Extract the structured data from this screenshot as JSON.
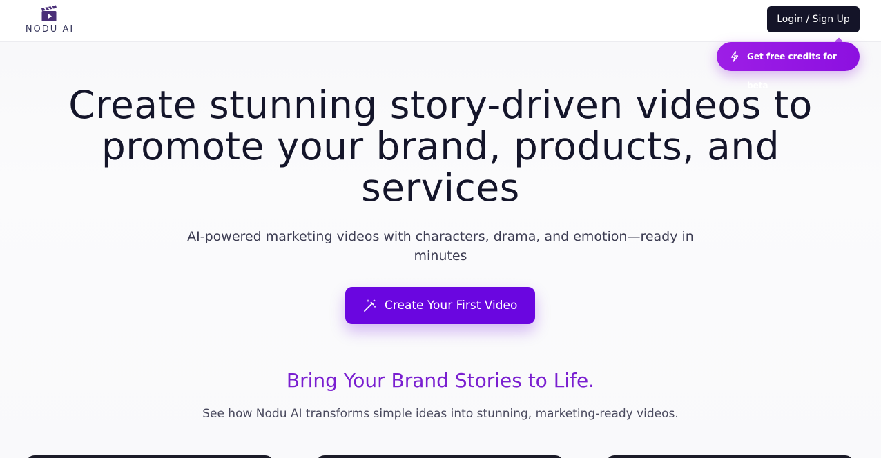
{
  "header": {
    "logo_text": "NODU AI",
    "login_label": "Login / Sign Up",
    "credits_label": "Get free credits for beta"
  },
  "hero": {
    "title": "Create stunning story-driven videos to promote your brand, products, and services",
    "subtitle": "AI-powered marketing videos with characters, drama, and emotion—ready in minutes",
    "cta_label": "Create Your First Video"
  },
  "section": {
    "title": "Bring Your Brand Stories to Life.",
    "subtitle": "See how Nodu AI transforms simple ideas into stunning, marketing-ready videos."
  },
  "icons": {
    "logo": "clapperboard-play-icon",
    "credits": "lightning-bolt-icon",
    "cta": "magic-wand-icon"
  },
  "colors": {
    "primary": "#6a06e0",
    "credits_gradient_start": "#9d1ee6",
    "accent_heading": "#7a1fd0",
    "dark": "#141428"
  }
}
